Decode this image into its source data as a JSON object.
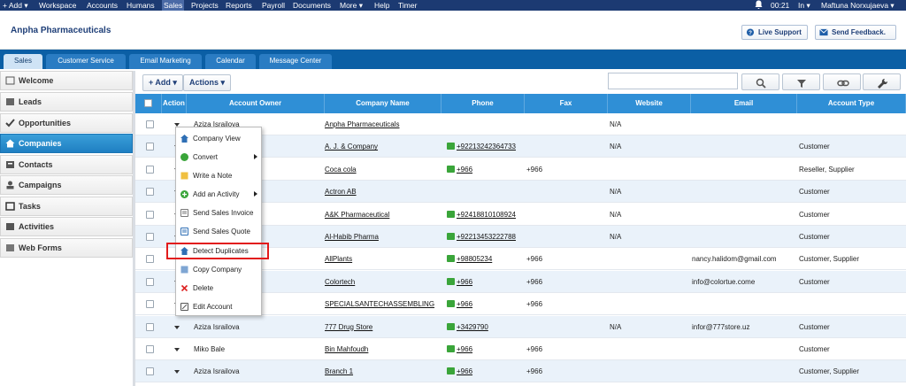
{
  "topbar": {
    "add": "+ Add ▾",
    "workspace": "Workspace",
    "accounts": "Accounts",
    "humans": "Humans",
    "sales": "Sales",
    "projects": "Projects",
    "reports": "Reports",
    "payroll": "Payroll",
    "documents": "Documents",
    "more": "More ▾",
    "help": "Help",
    "timer": "Timer",
    "time": "00:21",
    "in_status": "In ▾",
    "user": "Maftuna Norxujaeva ▾"
  },
  "header": {
    "title": "Anpha Pharmaceuticals",
    "live_support": "Live Support",
    "send_feedback": "Send Feedback."
  },
  "tabs": [
    "Sales",
    "Customer Service",
    "Email Marketing",
    "Calendar",
    "Message Center"
  ],
  "sidebar": [
    "Welcome",
    "Leads",
    "Opportunities",
    "Companies",
    "Contacts",
    "Campaigns",
    "Tasks",
    "Activities",
    "Web Forms"
  ],
  "toolbar": {
    "add": "+ Add ▾",
    "actions": "Actions ▾"
  },
  "columns": [
    "Action",
    "Account Owner",
    "Company Name",
    "Phone",
    "Fax",
    "Website",
    "Email",
    "Account Type"
  ],
  "rows": [
    {
      "owner": "Aziza Israilova",
      "company": "Anpha Pharmaceuticals",
      "phone": "",
      "fax": "",
      "website": "N/A",
      "email": "",
      "type": ""
    },
    {
      "owner": "",
      "company": "A. J. & Company",
      "phone": "+92213242364733",
      "fax": "",
      "website": "N/A",
      "email": "",
      "type": "Customer"
    },
    {
      "owner": "",
      "company": "Coca cola",
      "phone": "+966",
      "fax": "+966",
      "website": "",
      "email": "",
      "type": "Reseller, Supplier"
    },
    {
      "owner": "",
      "company": "Actron AB",
      "phone": "",
      "fax": "",
      "website": "N/A",
      "email": "",
      "type": "Customer"
    },
    {
      "owner": "",
      "company": "A&K Pharmaceutical",
      "phone": "+92418810108924",
      "fax": "",
      "website": "N/A",
      "email": "",
      "type": "Customer"
    },
    {
      "owner": "",
      "company": "Al-Habib Pharma",
      "phone": "+92213453222788",
      "fax": "",
      "website": "N/A",
      "email": "",
      "type": "Customer"
    },
    {
      "owner": "",
      "company": "AllPlants",
      "phone": "+98805234",
      "fax": "+966",
      "website": "",
      "email": "nancy.halidom@gmail.com",
      "type": "Customer, Supplier"
    },
    {
      "owner": "",
      "company": "Colortech",
      "phone": "+966",
      "fax": "+966",
      "website": "",
      "email": "info@colortue.come",
      "type": "Customer"
    },
    {
      "owner": "",
      "company": "SPECIALSANTECHASSEMBLING",
      "phone": "+966",
      "fax": "+966",
      "website": "",
      "email": "",
      "type": ""
    },
    {
      "owner": "Aziza Israilova",
      "company": "777 Drug Store",
      "phone": "+3429790",
      "fax": "",
      "website": "N/A",
      "email": "infor@777store.uz",
      "type": "Customer"
    },
    {
      "owner": "Miko Bale",
      "company": "Bin Mahfoudh",
      "phone": "+966",
      "fax": "+966",
      "website": "",
      "email": "",
      "type": "Customer"
    },
    {
      "owner": "Aziza Israilova",
      "company": "Branch 1",
      "phone": "+966",
      "fax": "+966",
      "website": "",
      "email": "",
      "type": "Customer, Supplier"
    }
  ],
  "menu": [
    "Company View",
    "Convert",
    "Write a Note",
    "Add an Activity",
    "Send Sales Invoice",
    "Send Sales Quote",
    "Detect Duplicates",
    "Copy Company",
    "Delete",
    "Edit Account"
  ],
  "colors": {
    "nav": "#1c3a72",
    "tabbar": "#0b5fa5",
    "grid_header": "#2f8fd6",
    "highlight": "#e21b1b"
  }
}
